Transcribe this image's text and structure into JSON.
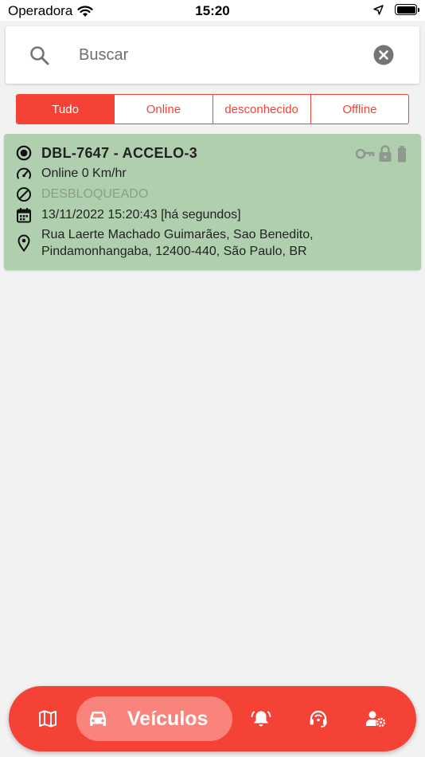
{
  "status_bar": {
    "carrier": "Operadora",
    "time": "15:20"
  },
  "search": {
    "placeholder": "Buscar"
  },
  "filters": {
    "all": "Tudo",
    "online": "Online",
    "unknown": "desconhecido",
    "offline": "Offline",
    "active": "Tudo"
  },
  "vehicle": {
    "name": "DBL-7647 - ACCELO-3",
    "speed": "Online 0 Km/hr",
    "lock_status": "DESBLOQUEADO",
    "datetime": "13/11/2022 15:20:43 [há segundos]",
    "address": "Rua Laerte Machado Guimarães, Sao Benedito, Pindamonhangaba, 12400-440, São Paulo, BR",
    "card_color": "#afcfaf"
  },
  "bottom_nav": {
    "active_label": "Veículos",
    "items": [
      "map-icon",
      "car-icon",
      "bell-icon",
      "support-icon",
      "user-settings-icon"
    ]
  },
  "colors": {
    "accent": "#f44336",
    "online_card": "#afcfaf"
  }
}
